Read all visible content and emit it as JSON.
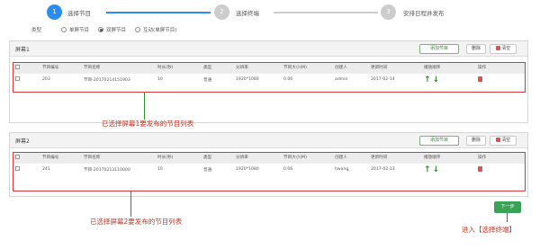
{
  "steps": [
    {
      "number": "1",
      "label": "选择节目",
      "state": "active"
    },
    {
      "number": "2",
      "label": "选择终端",
      "state": "pending"
    },
    {
      "number": "3",
      "label": "安排日程并发布",
      "state": "pending"
    }
  ],
  "colors": {
    "accent": "#2d8cf0",
    "pending": "#cccccc",
    "annotation": "#c0392b",
    "highlight_box": "#d43a3a",
    "next_button": "#3aa357",
    "arrow": "#2e8b2e"
  },
  "type_filter": {
    "label": "类型",
    "options": [
      {
        "label": "单屏节目",
        "selected": false
      },
      {
        "label": "双屏节目",
        "selected": true
      },
      {
        "label": "互动(单屏节目)",
        "selected": false
      }
    ]
  },
  "columns": [
    "节目编号",
    "节目名称",
    "时长(秒)",
    "类型",
    "分辨率",
    "节目大小(M)",
    "创建人",
    "更新时间",
    "播放顺序",
    "操作"
  ],
  "screens": [
    {
      "title": "屏幕1",
      "buttons": {
        "add": "添加节目",
        "clear": "删除",
        "filter": "清空"
      },
      "rows": [
        {
          "id": "203",
          "name": "节目-20170214151903",
          "duration": "10",
          "type": "普通",
          "resolution": "1920*1080",
          "size": "0.06",
          "creator": "admin",
          "updated": "2017-02-14"
        }
      ],
      "annotation": "已选择屏幕1要发布的节目列表"
    },
    {
      "title": "屏幕2",
      "buttons": {
        "add": "添加节目",
        "clear": "删除",
        "filter": "清空"
      },
      "rows": [
        {
          "id": "241",
          "name": "节目-20170213110000",
          "duration": "10",
          "type": "普通",
          "resolution": "1920*1080",
          "size": "0.06",
          "creator": "hwang",
          "updated": "2017-02-13"
        }
      ],
      "annotation": "已选择屏幕2要发布的节目列表"
    }
  ],
  "next_button": {
    "label": "下一步",
    "annotation": "进入【选择终端】"
  }
}
